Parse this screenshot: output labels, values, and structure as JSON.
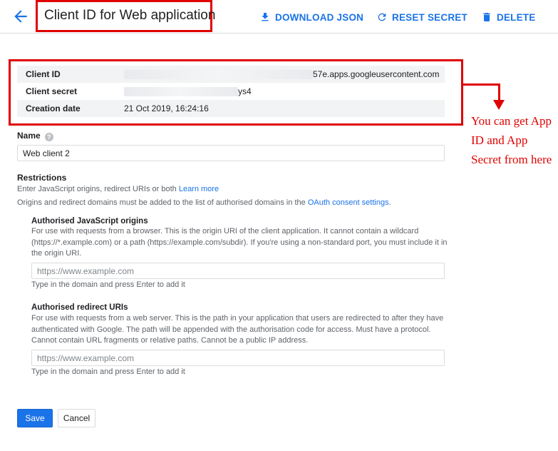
{
  "header": {
    "title": "Client ID for Web application",
    "actions": {
      "download": "DOWNLOAD JSON",
      "reset": "RESET SECRET",
      "delete": "DELETE"
    }
  },
  "info": {
    "client_id_label": "Client ID",
    "client_id_visible_suffix": "57e.apps.googleusercontent.com",
    "client_secret_label": "Client secret",
    "client_secret_visible_suffix": "ys4",
    "creation_date_label": "Creation date",
    "creation_date_value": "21 Oct 2019, 16:24:16"
  },
  "annotation": {
    "text": "You can get App ID and App Secret from here"
  },
  "form": {
    "name_label": "Name",
    "name_value": "Web client 2",
    "restrictions_title": "Restrictions",
    "restrictions_desc": "Enter JavaScript origins, redirect URIs or both",
    "learn_more": "Learn more",
    "domains_note": "Origins and redirect domains must be added to the list of authorised domains in the",
    "oauth_link": "OAuth consent settings",
    "js_origins": {
      "title": "Authorised JavaScript origins",
      "desc": "For use with requests from a browser. This is the origin URI of the client application. It cannot contain a wildcard (https://*.example.com) or a path (https://example.com/subdir). If you're using a non-standard port, you must include it in the origin URI.",
      "placeholder": "https://www.example.com",
      "hint": "Type in the domain and press Enter to add it"
    },
    "redirect_uris": {
      "title": "Authorised redirect URIs",
      "desc": "For use with requests from a web server. This is the path in your application that users are redirected to after they have authenticated with Google. The path will be appended with the authorisation code for access. Must have a protocol. Cannot contain URL fragments or relative paths. Cannot be a public IP address.",
      "placeholder": "https://www.example.com",
      "hint": "Type in the domain and press Enter to add it"
    },
    "save": "Save",
    "cancel": "Cancel"
  },
  "colors": {
    "accent": "#1a73e8",
    "annotation_red": "#e00000"
  }
}
